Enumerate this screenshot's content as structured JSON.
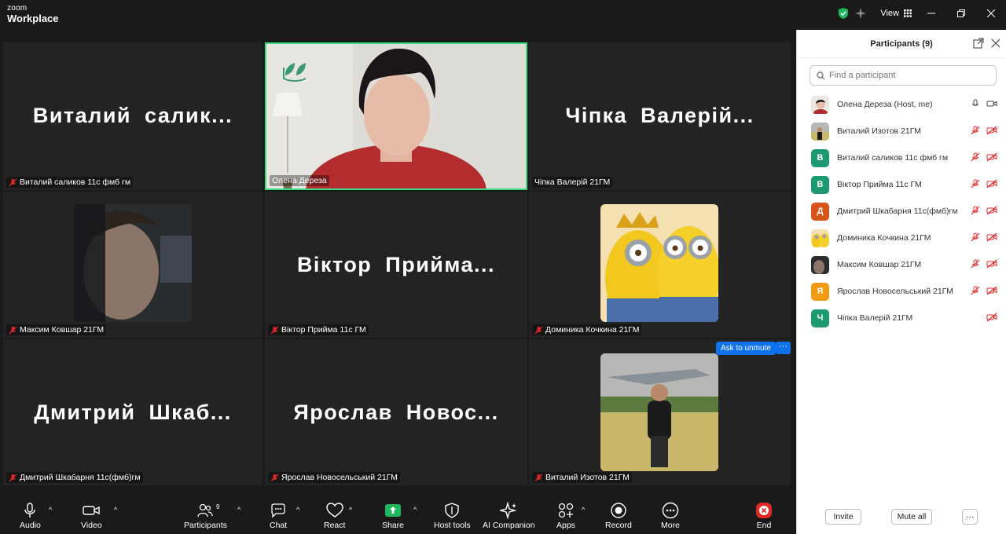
{
  "app": {
    "brand_small": "zoom",
    "brand_large": "Workplace",
    "view_label": "View"
  },
  "tiles": {
    "vitaliy_s": {
      "big": "Виталий  салик...",
      "label": "Виталий саликов 11с фмб гм"
    },
    "olena": {
      "label": "Олена Дереза"
    },
    "chipka": {
      "big": "Чіпка  Валерій...",
      "label": "Чіпка Валерій 21ГМ"
    },
    "maksym": {
      "label": "Максим Ковшар 21ГМ"
    },
    "viktor": {
      "big": "Віктор  Прийма...",
      "label": "Віктор Прийма 11с ГМ"
    },
    "dominika": {
      "label": "Доминика Кочкина 21ГМ"
    },
    "dmytriy": {
      "big": "Дмитрий  Шкаб...",
      "label": "Дмитрий Шкабарня 11с(фмб)гм"
    },
    "yaroslav": {
      "big": "Ярослав  Новос...",
      "label": "Ярослав Новосельський 21ГМ"
    },
    "vitaliy_i": {
      "label": "Виталий Изотов 21ГМ"
    },
    "ask_unmute": "Ask to unmute",
    "more_dots": "···"
  },
  "toolbar": {
    "audio": "Audio",
    "video": "Video",
    "participants": "Participants",
    "participants_count": "9",
    "chat": "Chat",
    "react": "React",
    "share": "Share",
    "host_tools": "Host tools",
    "ai_companion": "AI Companion",
    "apps": "Apps",
    "record": "Record",
    "more": "More",
    "end": "End"
  },
  "panel": {
    "title": "Participants (9)",
    "search_placeholder": "Find a participant",
    "participants": [
      {
        "name": "Олена Дереза (Host, me)",
        "initial": "",
        "color": "#d9c9c0",
        "photo": true
      },
      {
        "name": "Виталий Изотов 21ГМ",
        "initial": "",
        "color": "#8a8a6a",
        "photo": true
      },
      {
        "name": "Виталий саликов 11с фмб гм",
        "initial": "В",
        "color": "#1d9a72",
        "photo": false
      },
      {
        "name": "Віктор Прийма 11с ГМ",
        "initial": "В",
        "color": "#1d9a72",
        "photo": false
      },
      {
        "name": "Дмитрий Шкабарня 11с(фмб)гм",
        "initial": "Д",
        "color": "#d9541a",
        "photo": false
      },
      {
        "name": "Доминика Кочкина 21ГМ",
        "initial": "",
        "color": "#d9a21a",
        "photo": true
      },
      {
        "name": "Максим Ковшар 21ГМ",
        "initial": "",
        "color": "#666",
        "photo": true
      },
      {
        "name": "Ярослав Новосельський 21ГМ",
        "initial": "Я",
        "color": "#f29a12",
        "photo": false
      },
      {
        "name": "Чіпка Валерій 21ГМ",
        "initial": "Ч",
        "color": "#1d9a72",
        "photo": false
      }
    ],
    "invite": "Invite",
    "mute_all": "Mute all",
    "more": "···"
  },
  "colors": {
    "accent": "#0e72ed",
    "speaker_border": "#3ddc84",
    "muted": "#e02828",
    "end": "#e02828"
  }
}
